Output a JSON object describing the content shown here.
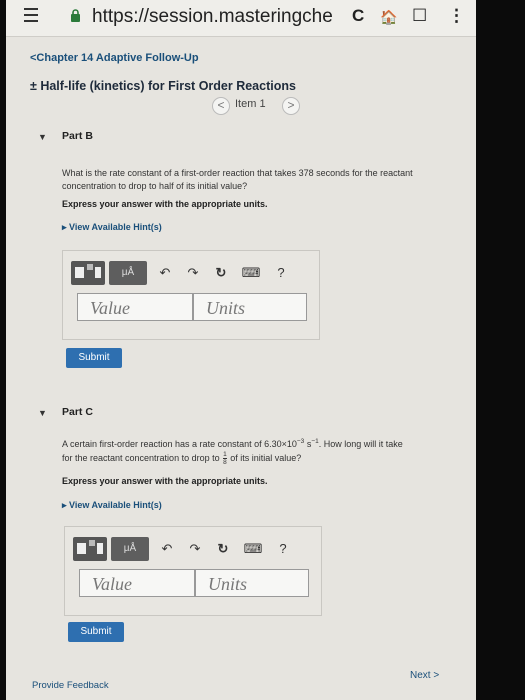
{
  "browser": {
    "url": "https://session.masteringche",
    "menu_icon": "hamburger-icon",
    "lock_icon": "lock-icon",
    "reload_glyph": "C",
    "home_glyph": "🏠",
    "bookmark_glyph": "☐",
    "more_glyph": "⋮"
  },
  "header": {
    "breadcrumb": "<Chapter 14 Adaptive Follow-Up",
    "title": "± Half-life (kinetics) for First Order Reactions",
    "item_label": "Item 1",
    "prev_glyph": "<",
    "next_glyph": ">"
  },
  "partB": {
    "caret": "▼",
    "title": "Part B",
    "question": "What is the rate constant of a first-order reaction that takes 378 seconds for the reactant concentration to drop to half of its initial value?",
    "instruction": "Express your answer with the appropriate units.",
    "hint": "▸ View Available Hint(s)",
    "value_placeholder": "Value",
    "units_placeholder": "Units",
    "submit": "Submit"
  },
  "partC": {
    "caret": "▼",
    "title": "Part C",
    "question_a": "A certain first-order reaction has a rate constant of 6.30×10",
    "exp1": "−3",
    "unit_s": " s",
    "exp2": "−1",
    "question_b": ". How long will it take",
    "question_c": "for the reactant concentration to drop to ",
    "frac_num": "1",
    "frac_den": "8",
    "question_d": " of its initial value?",
    "instruction": "Express your answer with the appropriate units.",
    "hint": "▸ View Available Hint(s)",
    "value_placeholder": "Value",
    "units_placeholder": "Units",
    "submit": "Submit"
  },
  "toolbar": {
    "mu_label": "μÅ",
    "undo_glyph": "↶",
    "redo_glyph": "↷",
    "reset_glyph": "↻",
    "keyboard_glyph": "⌨",
    "help_glyph": "?"
  },
  "footer": {
    "feedback": "Provide Feedback",
    "next": "Next >"
  }
}
